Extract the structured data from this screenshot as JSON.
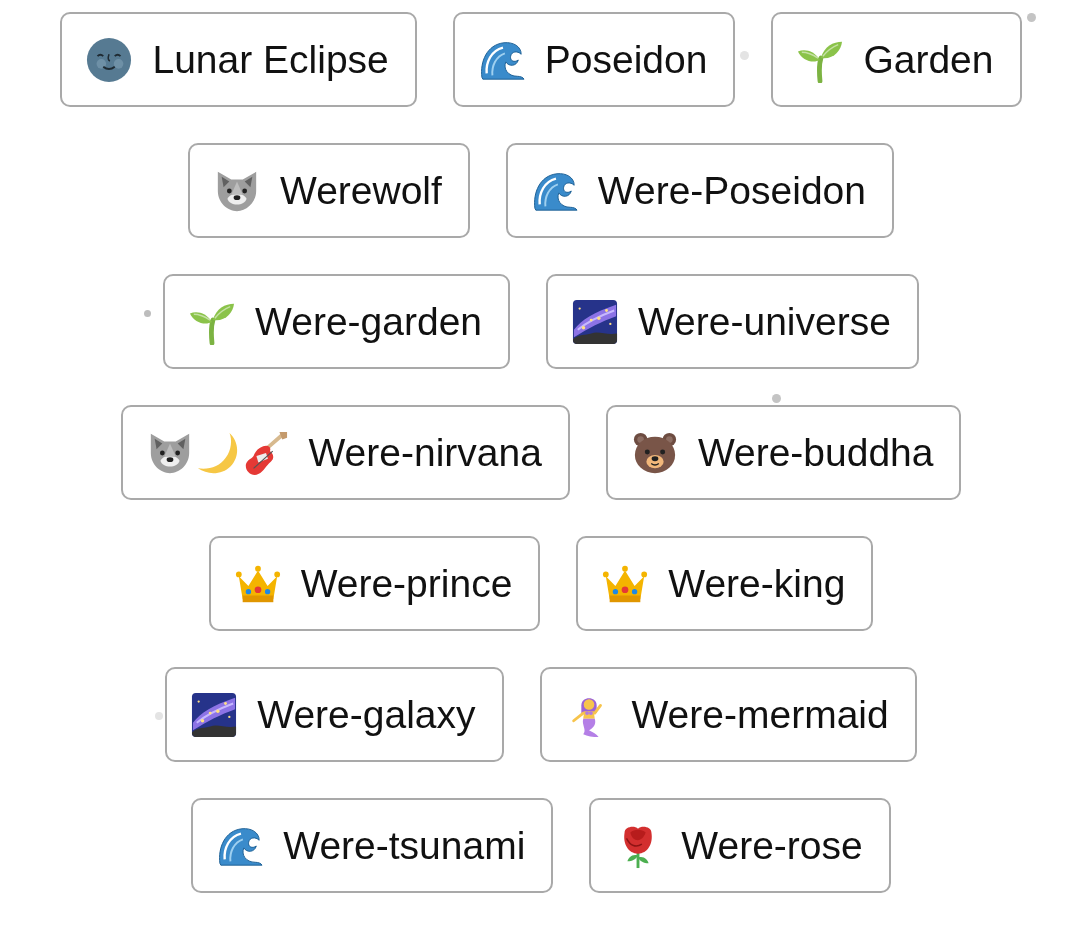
{
  "rows": [
    [
      {
        "label": "Lunar Eclipse",
        "icons": [
          {
            "kind": "moonface"
          }
        ]
      },
      {
        "label": "Poseidon",
        "icons": [
          {
            "kind": "wave"
          }
        ]
      },
      {
        "label": "Garden",
        "icons": [
          {
            "kind": "sprout"
          }
        ]
      }
    ],
    [
      {
        "label": "Werewolf",
        "icons": [
          {
            "kind": "wolf"
          }
        ]
      },
      {
        "label": "Were-Poseidon",
        "icons": [
          {
            "kind": "wave"
          }
        ]
      }
    ],
    [
      {
        "label": "Were-garden",
        "icons": [
          {
            "kind": "sprout"
          }
        ]
      },
      {
        "label": "Were-universe",
        "icons": [
          {
            "kind": "galaxy"
          }
        ]
      }
    ],
    [
      {
        "label": "Were-nirvana",
        "icons": [
          {
            "kind": "wolf"
          },
          {
            "kind": "crescent"
          },
          {
            "kind": "guitar"
          }
        ]
      },
      {
        "label": "Were-buddha",
        "icons": [
          {
            "kind": "bear"
          }
        ]
      }
    ],
    [
      {
        "label": "Were-prince",
        "icons": [
          {
            "kind": "crown"
          }
        ]
      },
      {
        "label": "Were-king",
        "icons": [
          {
            "kind": "crown"
          }
        ]
      }
    ],
    [
      {
        "label": "Were-galaxy",
        "icons": [
          {
            "kind": "galaxy"
          }
        ]
      },
      {
        "label": "Were-mermaid",
        "icons": [
          {
            "kind": "mermaid"
          }
        ]
      }
    ],
    [
      {
        "label": "Were-tsunami",
        "icons": [
          {
            "kind": "wave"
          }
        ]
      },
      {
        "label": "Were-rose",
        "icons": [
          {
            "kind": "rose"
          }
        ]
      }
    ]
  ]
}
